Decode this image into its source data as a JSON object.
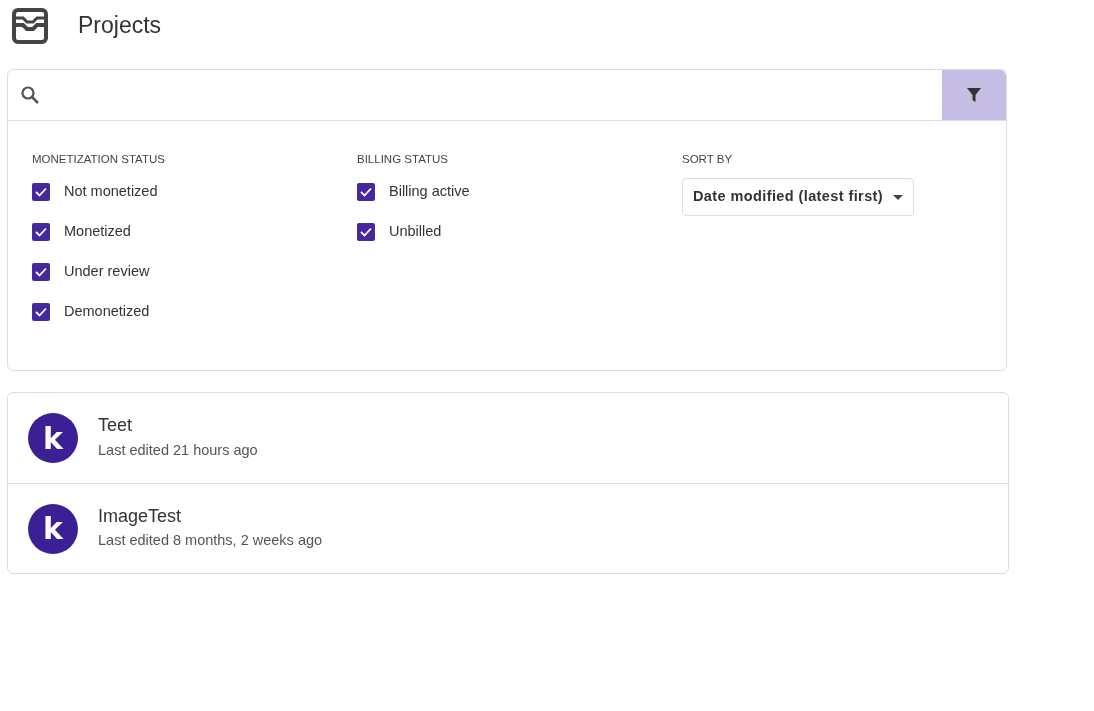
{
  "header": {
    "title": "Projects"
  },
  "filters": [
    {
      "kind": "checks",
      "heading": "MONETIZATION STATUS",
      "options": [
        {
          "label": "Not monetized",
          "checked": true
        },
        {
          "label": "Monetized",
          "checked": true
        },
        {
          "label": "Under review",
          "checked": true
        },
        {
          "label": "Demonetized",
          "checked": true
        }
      ]
    },
    {
      "kind": "checks",
      "heading": "BILLING STATUS",
      "options": [
        {
          "label": "Billing active",
          "checked": true
        },
        {
          "label": "Unbilled",
          "checked": true
        }
      ]
    },
    {
      "kind": "select",
      "heading": "SORT BY",
      "value": "Date modified (latest first)"
    }
  ],
  "projects": [
    {
      "avatar_letter": "k",
      "name": "Teet",
      "subtitle": "Last edited 21 hours ago"
    },
    {
      "avatar_letter": "k",
      "name": "ImageTest",
      "subtitle": "Last edited 8 months, 2 weeks ago"
    }
  ]
}
